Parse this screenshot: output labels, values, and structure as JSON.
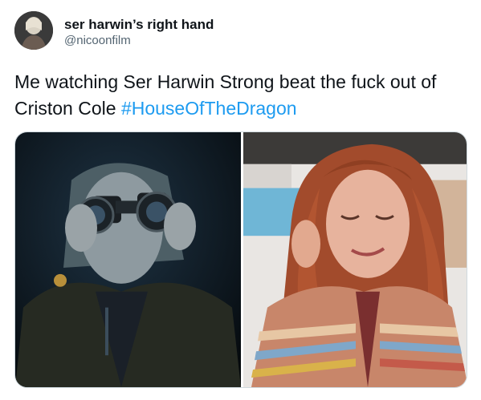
{
  "user": {
    "display_name": "ser harwin’s right hand",
    "handle": "@nicoonfilm"
  },
  "tweet": {
    "text": "Me watching Ser Harwin Strong beat the fuck out of Criston Cole ",
    "hashtag": "#HouseOfTheDragon"
  },
  "media": {
    "left_image": "woman-with-binoculars-at-night",
    "right_image": "red-haired-woman-smiling-touching-hair"
  },
  "colors": {
    "link": "#1d9bf0",
    "secondary_text": "#536471",
    "primary_text": "#0f1419"
  }
}
